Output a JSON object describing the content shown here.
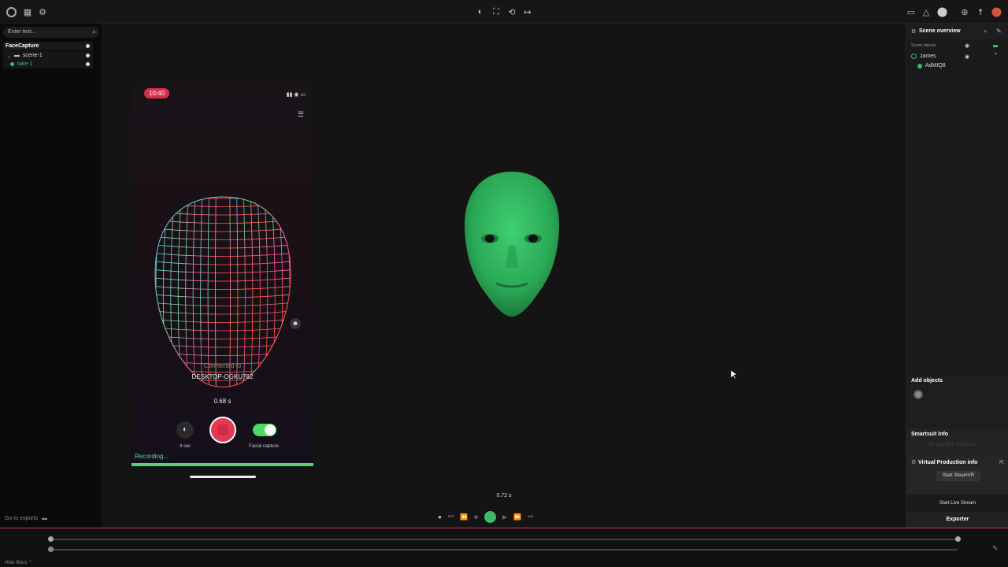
{
  "toolbar": {
    "left_icons": [
      "logo-icon",
      "layout-icon",
      "gear-icon"
    ],
    "center_icons": [
      "capture-icon",
      "frame-icon",
      "rotate-icon",
      "arrow-icon"
    ],
    "right_icons": [
      "screen-icon",
      "warning-icon",
      "status-icon",
      "globe-icon",
      "figure-icon",
      "user-icon"
    ]
  },
  "left_panel": {
    "search_placeholder": "Enter text...",
    "project": "FaceCapture",
    "scene": "scene-1",
    "take": "take-1",
    "go_to_exports": "Go to exports"
  },
  "phone": {
    "time": "10:40",
    "connected_label": "Connected to",
    "device_name": "DESKTOP-OGKU762",
    "elapsed": "0.68 s",
    "timer_label": "4 sec",
    "facial_capture_label": "Facial capture",
    "recording_label": "Recording..."
  },
  "viewport": {
    "playhead_time": "0.72 s",
    "accent_color": "#3dbb6a"
  },
  "right_panel": {
    "title": "Scene overview",
    "scene_objects_label": "Scene objects",
    "objects": [
      {
        "label": "James"
      },
      {
        "label": "AdMIQ8"
      }
    ],
    "add_objects": "Add objects",
    "smartsuit_info": "Smartsuit info",
    "no_smartsuit": "No available smartsuit",
    "vp_info": "Virtual Production info",
    "start_steamvr": "Start SteamVR",
    "start_live_stream": "Start Live Stream",
    "exporter": "Exporter"
  },
  "bottom": {
    "hide_filters": "Hide filters"
  }
}
